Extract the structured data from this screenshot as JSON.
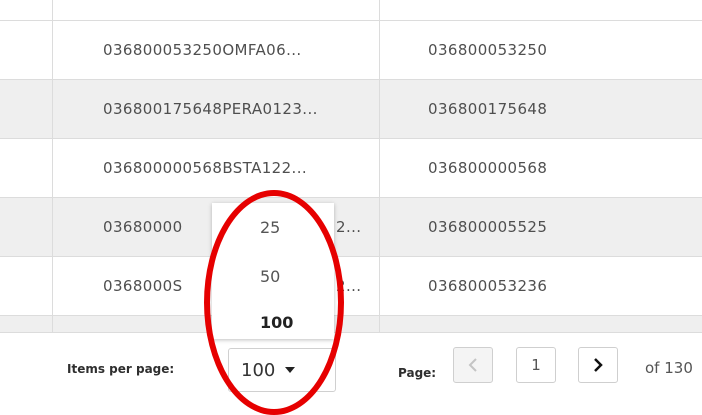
{
  "table": {
    "rows": [
      {
        "col1": "036800053250OMFA06...",
        "col2": "036800053250"
      },
      {
        "col1": "036800175648PERA0123...",
        "col2": "036800175648"
      },
      {
        "col1": "036800000568BSTA122...",
        "col2": "036800000568"
      },
      {
        "col1": "03680000",
        "col1_tail": "2...",
        "col2": "036800005525"
      },
      {
        "col1": "0368000S",
        "col1_tail": "2...",
        "col2": "036800053236"
      }
    ]
  },
  "pagination": {
    "items_per_page_label": "Items per page:",
    "items_per_page_value": "100",
    "options": [
      "25",
      "50",
      "100"
    ],
    "page_label": "Page:",
    "current_page": "1",
    "of_text": "of 130"
  },
  "colors": {
    "annotation": "#e60000",
    "row_shade": "#efefef"
  }
}
